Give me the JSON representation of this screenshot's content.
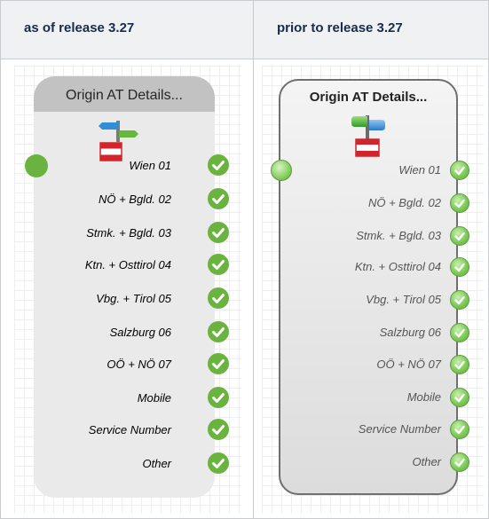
{
  "columns": {
    "new_header": "as of release 3.27",
    "old_header": "prior to release 3.27"
  },
  "node_title": "Origin AT Details...",
  "outputs": [
    "Wien 01",
    "NÖ + Bgld. 02",
    "Stmk. + Bgld. 03",
    "Ktn. + Osttirol 04",
    "Vbg. + Tirol 05",
    "Salzburg 06",
    "OÖ + NÖ 07",
    "Mobile",
    "Service Number",
    "Other"
  ],
  "colors": {
    "new_check": "#6bb33f",
    "new_input": "#6bb33f",
    "old_check": "#7fcb58",
    "header_bg": "#f0f1f2"
  },
  "icons": {
    "node_icon": "signpost-flag-icon",
    "output_icon": "check-icon"
  }
}
